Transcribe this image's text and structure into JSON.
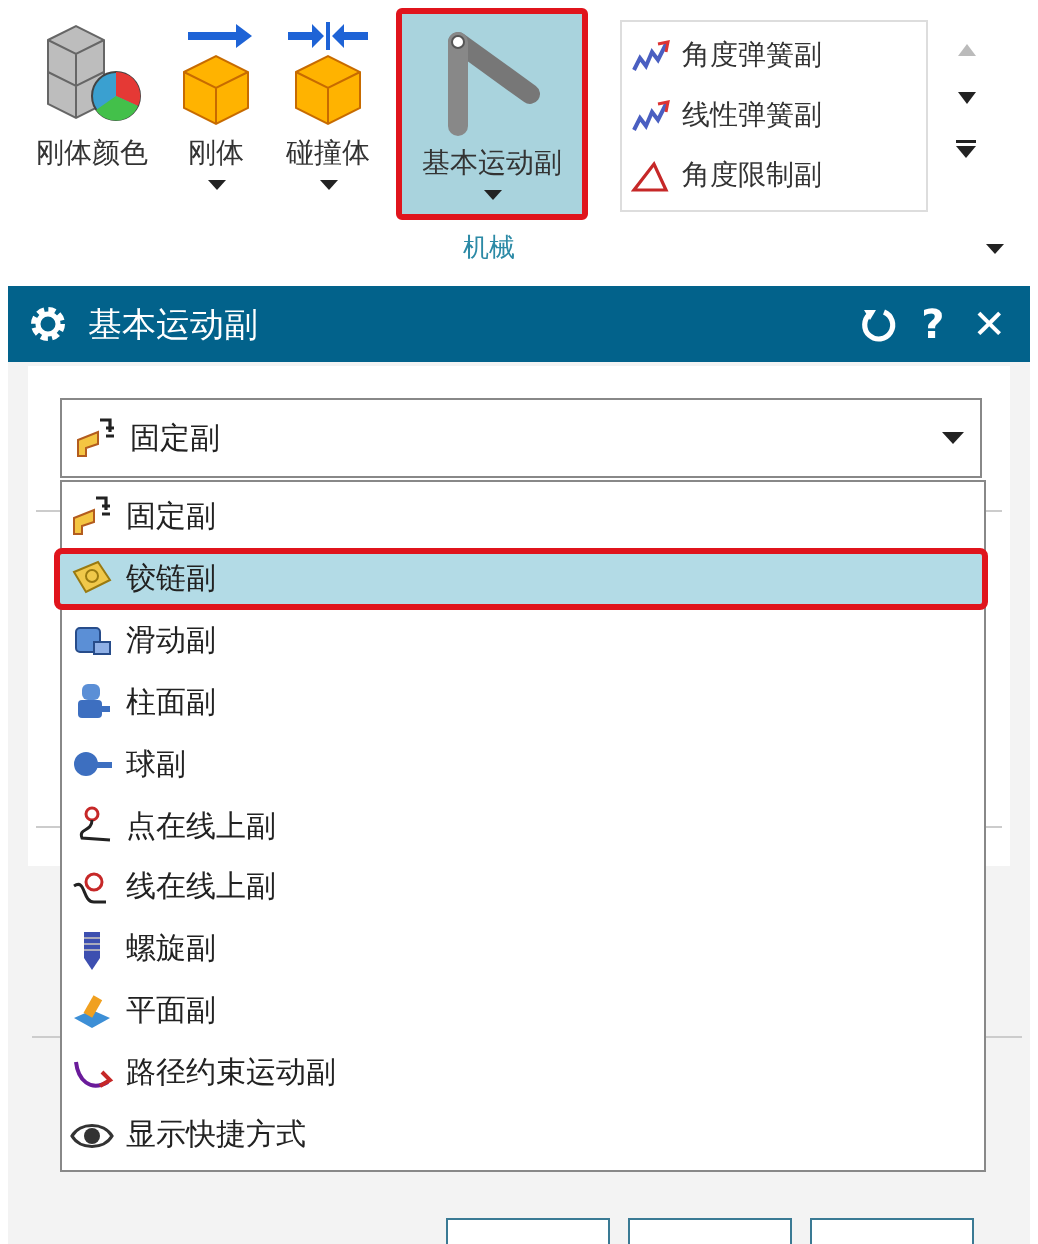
{
  "ribbon": {
    "buttons": [
      {
        "kind": "color",
        "label": "刚体颜色",
        "has_dropdown": false,
        "selected": false
      },
      {
        "kind": "body",
        "label": "刚体",
        "has_dropdown": true,
        "selected": false
      },
      {
        "kind": "collision",
        "label": "碰撞体",
        "has_dropdown": true,
        "selected": false
      },
      {
        "kind": "joint",
        "label": "基本运动副",
        "has_dropdown": true,
        "selected": true
      }
    ],
    "gallery": [
      {
        "kind": "spring",
        "label": "角度弹簧副"
      },
      {
        "kind": "spring",
        "label": "线性弹簧副"
      },
      {
        "kind": "limit",
        "label": "角度限制副"
      }
    ],
    "group_label": "机械"
  },
  "dialog": {
    "title": "基本运动副",
    "help": "?",
    "close": "✕",
    "combobox": {
      "value": "固定副"
    },
    "options": [
      {
        "label": "固定副",
        "selected": false
      },
      {
        "label": "铰链副",
        "selected": true
      },
      {
        "label": "滑动副",
        "selected": false
      },
      {
        "label": "柱面副",
        "selected": false
      },
      {
        "label": "球副",
        "selected": false
      },
      {
        "label": "点在线上副",
        "selected": false
      },
      {
        "label": "线在线上副",
        "selected": false
      },
      {
        "label": "螺旋副",
        "selected": false
      },
      {
        "label": "平面副",
        "selected": false
      },
      {
        "label": "路径约束运动副",
        "selected": false
      },
      {
        "label": "显示快捷方式",
        "selected": false
      }
    ],
    "footer_buttons": [
      {
        "kind": "button"
      },
      {
        "kind": "button"
      },
      {
        "kind": "button"
      }
    ]
  }
}
